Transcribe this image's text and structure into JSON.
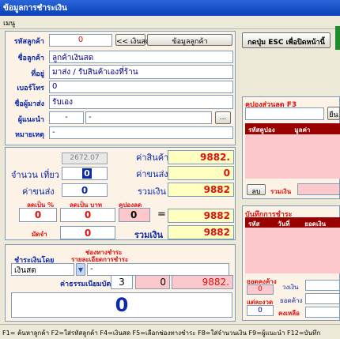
{
  "window": {
    "title": "ข้อมูลการชำระเงิน"
  },
  "menu": {
    "label": "เมนู"
  },
  "customer": {
    "code_label": "รหัสลูกค้า",
    "code_value": "0",
    "cash_button": "<< เงินสด",
    "info_button": "ข้อมูลลูกค้า",
    "name_label": "ชื่อลูกค้า",
    "name_value": "ลูกค้าเงินสด",
    "address_label": "ที่อยู่",
    "address_value": "มาส่ง / รับสินค้าเองที่ร้าน",
    "phone_label": "เบอร์โทร",
    "phone_value": "0",
    "receiver_label": "ชื่อผู้มาส่ง",
    "receiver_value": "รับเอง",
    "referrer_label": "ผู้แนะนำ",
    "referrer_code": "-",
    "referrer_name": "-",
    "referrer_button": "...",
    "note_label": "หมายเหตุ",
    "note_value": "-"
  },
  "header_buttons": {
    "esc_button": "กดปุ่ม ESC เพื่อปิดหน้านี้"
  },
  "totals": {
    "grey_value": "2672.07",
    "goods_label": "ค่าสินค้า",
    "goods_value": "9882.",
    "trips_label": "จำนวน เที่ยว",
    "trips_value": "0",
    "delivery_label": "ค่าขนส่ง",
    "delivery_value": "0",
    "delivery_label2": "ค่าขนส่ง",
    "delivery_value2": "0",
    "sum_label": "รวมเงิน",
    "sum_value": "9882",
    "discount_pct_label": "ลดเป็น %",
    "discount_baht_label": "ลดเป็น บาท",
    "coupon_label": "คูปองลด",
    "discount_pct_value": "0",
    "discount_baht_value": "0",
    "coupon_value": "0",
    "equals": "=",
    "after_discount_value": "9882",
    "deposit_label": "มัดจำ",
    "deposit_value": "0",
    "total_label": "รวมเงิน",
    "total_value": "9882"
  },
  "payment": {
    "method_label": "ชำระเงินโดย",
    "channel_label_line1": "ช่องทางชำระ",
    "channel_label_line2": "รายละเอียดการชำระ",
    "method_value": "เงินสด",
    "channel_value": "-",
    "fee_label": "ค่าธรรมเนียมบัตร",
    "fee_pct": "3",
    "fee_value": "0",
    "fee_total": "9882.",
    "big_value": "0"
  },
  "coupon_panel": {
    "title": "คูปองส่วนลด F3",
    "search_button": "ยืน",
    "col_code": "รหัสคูปอง",
    "col_value": "มูลค่า",
    "delete_button": "ลบ",
    "sum_label": "รวมเงิน",
    "sum_value": ""
  },
  "payment_log": {
    "title": "บันทึกการชำระ",
    "col_code": "รหัส",
    "col_date": "วันที่",
    "col_amount": "ยอดเงิน",
    "remaining_label": "ยอดคงค้าง",
    "remaining_value": "0",
    "installment_label": "แต่ละงวด",
    "installment_value": "0",
    "date_label": "วงเงิน",
    "balance_label": "ยอดค้าง",
    "pending_label": "คงเหลือ"
  },
  "status": {
    "text": "F1= ค้นหาลูกค้า  F2=ใส่รหัสลูกค้า  F4=เงินสด  F5=เลือกช่องทางชำระ  F8=ใส่จำนวนเงิน F9=ผู้แนะนำ  F12=บันทึก"
  },
  "colors": {
    "title_bar": "#0a3fb8",
    "label_blue": "#0b2aa8",
    "accent_red": "#e01010",
    "table_header": "#990000",
    "panel_bg": "#fdf2e6"
  }
}
